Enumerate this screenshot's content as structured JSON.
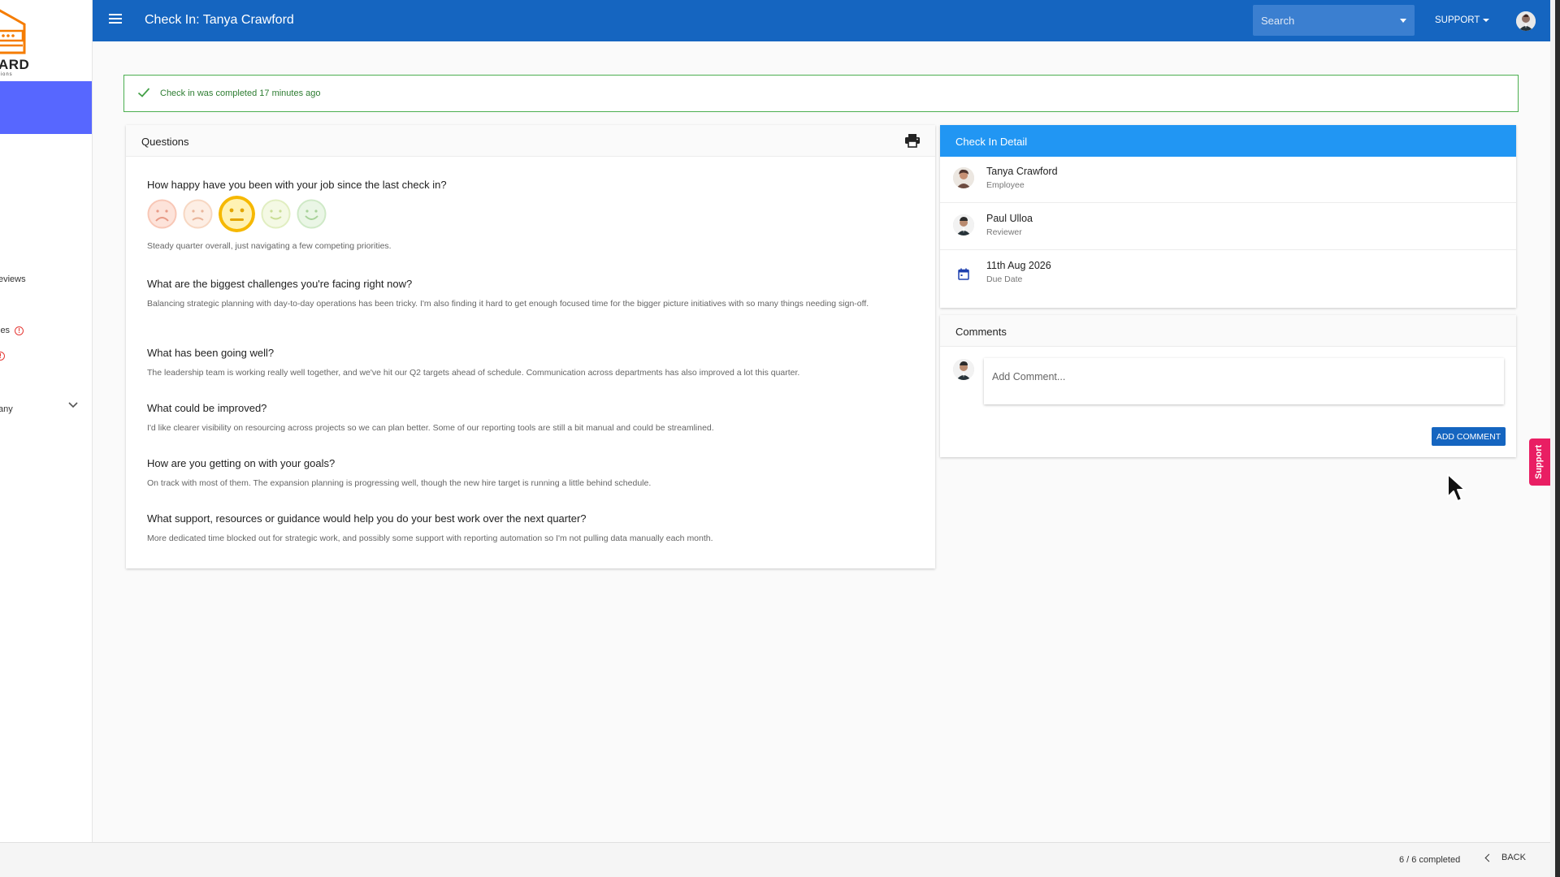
{
  "header": {
    "title": "Check In: Tanya Crawford",
    "search_placeholder": "Search",
    "support_label": "SUPPORT"
  },
  "sidebar": {
    "logo_text": "ARD",
    "logo_sub": "tions",
    "items": [
      {
        "label": "eviews"
      },
      {
        "label": "ies"
      },
      {
        "label": "any"
      }
    ]
  },
  "alert": {
    "message": "Check in was completed 17 minutes ago"
  },
  "questions_card": {
    "title": "Questions",
    "items": [
      {
        "question": "How happy have you been with your job since the last check in?",
        "answer": "Steady quarter overall, just navigating a few competing priorities.",
        "rating": 3,
        "rating_max": 5
      },
      {
        "question": "What are the biggest challenges you're facing right now?",
        "answer": "Balancing strategic planning with day-to-day operations has been tricky. I'm also finding it hard to get enough focused time for the bigger picture initiatives with so many things needing sign-off."
      },
      {
        "question": "What has been going well?",
        "answer": "The leadership team is working really well together, and we've hit our Q2 targets ahead of schedule. Communication across departments has also improved a lot this quarter."
      },
      {
        "question": "What could be improved?",
        "answer": "I'd like clearer visibility on resourcing across projects so we can plan better. Some of our reporting tools are still a bit manual and could be streamlined."
      },
      {
        "question": "How are you getting on with your goals?",
        "answer": "On track with most of them. The expansion planning is progressing well, though the new hire target is running a little behind schedule."
      },
      {
        "question": "What support, resources or guidance would help you do your best work over the next quarter?",
        "answer": "More dedicated time blocked out for strategic work, and possibly some support with reporting automation so I'm not pulling data manually each month."
      }
    ]
  },
  "detail_card": {
    "title": "Check In Detail",
    "employee": {
      "name": "Tanya Crawford",
      "role": "Employee"
    },
    "reviewer": {
      "name": "Paul Ulloa",
      "role": "Reviewer"
    },
    "due": {
      "date": "11th Aug 2026",
      "label": "Due Date"
    }
  },
  "comments_card": {
    "title": "Comments",
    "placeholder": "Add Comment...",
    "button_label": "ADD COMMENT"
  },
  "support_tab": {
    "label": "Support"
  },
  "footer": {
    "progress": "6 / 6 completed",
    "back_label": "BACK"
  },
  "colors": {
    "topbar": "#1565c0",
    "detail_header": "#2196f3",
    "success": "#4caf50",
    "sidebar_active": "#5767ff",
    "support_tab": "#e91e63",
    "selected_face": "#f6b800"
  }
}
